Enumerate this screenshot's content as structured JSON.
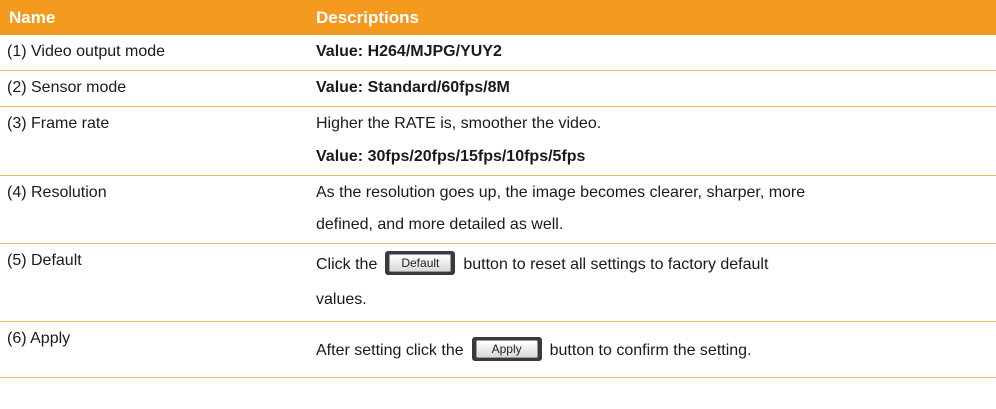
{
  "header": {
    "name": "Name",
    "descriptions": "Descriptions"
  },
  "rows": [
    {
      "name": "(1) Video output mode",
      "desc": "Value: H264/MJPG/YUY2"
    },
    {
      "name": "(2) Sensor mode",
      "desc": "Value: Standard/60fps/8M"
    },
    {
      "name": "(3) Frame rate",
      "desc_line1": "Higher the RATE is, smoother the video.",
      "desc_line2": "Value: 30fps/20fps/15fps/10fps/5fps"
    },
    {
      "name": "(4) Resolution",
      "desc_line1": "As the resolution goes up, the image becomes clearer, sharper, more",
      "desc_line2": "defined, and more detailed as well."
    },
    {
      "name": "(5) Default",
      "desc_pre": "Click the",
      "button": "Default",
      "desc_post": "button to reset all settings to factory default",
      "desc_line2": "values."
    },
    {
      "name": "(6) Apply",
      "desc_pre": "After setting click the",
      "button": "Apply",
      "desc_post": "button to confirm the setting."
    }
  ],
  "colors": {
    "header_bg": "#f39a1f",
    "divider": "#f4b561"
  }
}
